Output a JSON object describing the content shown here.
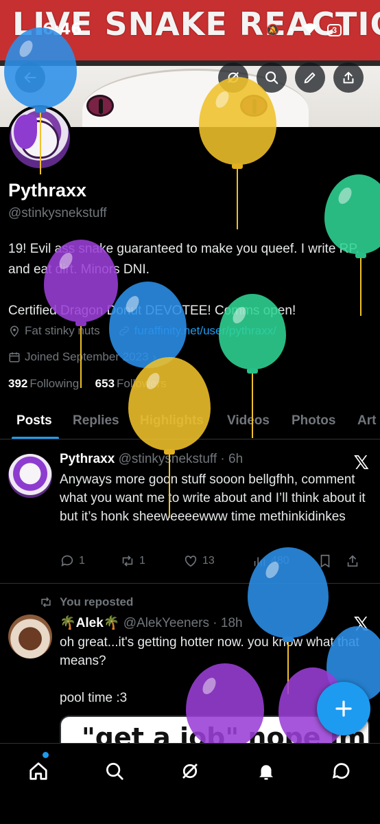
{
  "banner": {
    "text": "LIVE SNAKE REACTION"
  },
  "status_bar": {
    "time": "6:46",
    "battery": "3"
  },
  "header_buttons": [
    "back-icon",
    "grok-icon",
    "search-icon",
    "edit-icon",
    "share-icon"
  ],
  "profile": {
    "name": "Pythraxx",
    "handle": "@stinkysnekstuff",
    "bio": "19! Evil ass snake guaranteed to make you queef. I write RP, and eat dirt. Minors DNI.\n\nCertified Dragon Donut DEVOTEE! Comms open!",
    "location": "Fat stinky nuts",
    "link": "furaffinity.net/user/pythraxx/",
    "joined": "Joined September 2023",
    "following_count": "392",
    "following_label": "Following",
    "followers_count": "653",
    "followers_label": "Followers"
  },
  "tabs": [
    "Posts",
    "Replies",
    "Highlights",
    "Videos",
    "Photos",
    "Art"
  ],
  "posts": [
    {
      "name": "Pythraxx",
      "meta": "@stinkysnekstuff · 6h",
      "text": "Anyways more goon stuff sooon bellgfhh, comment what you want me to write about and I’ll think about it but it’s honk sheeweeeewww time methinkidinkes",
      "replies": "1",
      "reposts": "1",
      "likes": "13",
      "views": "480"
    },
    {
      "repost_note": "You reposted",
      "name": "🌴Alek🌴",
      "meta": "@AlekYeeners · 18h",
      "text": "oh great...it's getting hotter now. you know what that means?\n\npool time :3",
      "image_text": "\"get a job\" nope im"
    }
  ],
  "balloon_colors": {
    "blue": "#2b8fe8",
    "yellow": "#f0c12a",
    "green": "#2fd494",
    "purple": "#9a3fd6"
  },
  "accent": "#1d9bf0"
}
